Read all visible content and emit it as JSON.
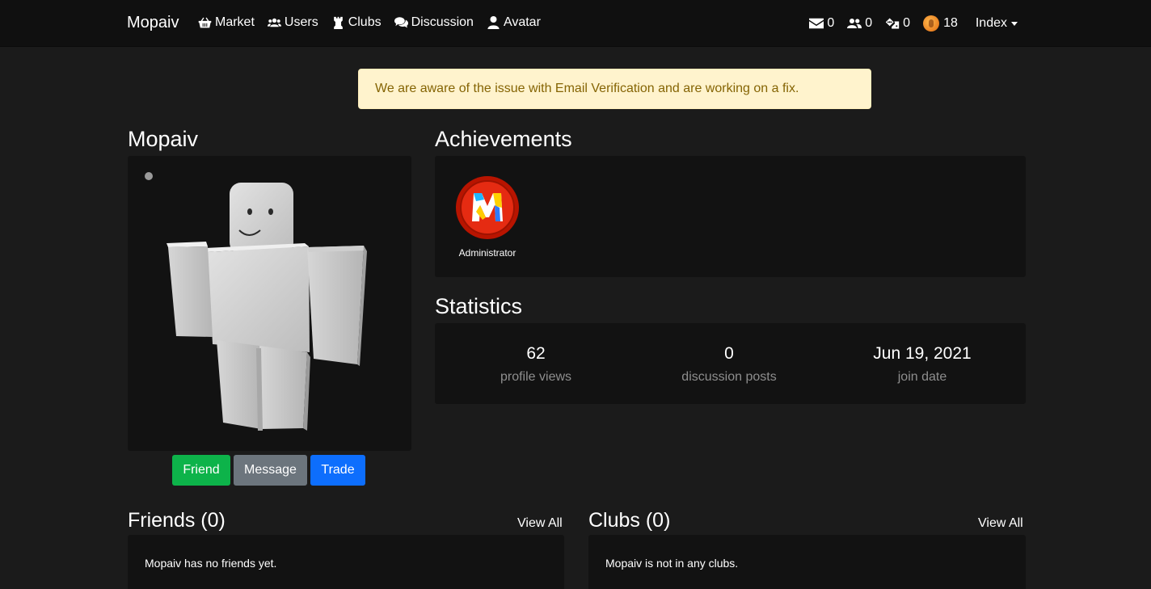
{
  "nav": {
    "brand": "Mopaiv",
    "links": [
      {
        "label": "Market",
        "icon": "basket-icon"
      },
      {
        "label": "Users",
        "icon": "users-icon"
      },
      {
        "label": "Clubs",
        "icon": "chess-rook-icon"
      },
      {
        "label": "Discussion",
        "icon": "comments-icon"
      },
      {
        "label": "Avatar",
        "icon": "user-icon"
      }
    ],
    "messages_count": "0",
    "friend_requests_count": "0",
    "trades_count": "0",
    "currency_amount": "18",
    "index_label": "Index"
  },
  "alert": {
    "text": "We are aware of the issue with Email Verification and are working on a fix."
  },
  "profile": {
    "username": "Mopaiv",
    "status": "offline",
    "buttons": {
      "friend": "Friend",
      "message": "Message",
      "trade": "Trade"
    }
  },
  "achievements": {
    "title": "Achievements",
    "items": [
      {
        "label": "Administrator",
        "icon": "administrator-badge-icon"
      }
    ]
  },
  "statistics": {
    "title": "Statistics",
    "profile_views": {
      "value": "62",
      "label": "profile views"
    },
    "discussion_posts": {
      "value": "0",
      "label": "discussion posts"
    },
    "join_date": {
      "value": "Jun 19, 2021",
      "label": "join date"
    }
  },
  "friends": {
    "title": "Friends (0)",
    "view_all": "View All",
    "empty": "Mopaiv has no friends yet."
  },
  "clubs": {
    "title": "Clubs (0)",
    "view_all": "View All",
    "empty": "Mopaiv is not in any clubs."
  },
  "colors": {
    "background": "#1b1b1b",
    "navbar": "#101010",
    "panel": "#121212",
    "alert_bg": "#fff3cd",
    "alert_text": "#856404",
    "friend_button": "#0db34a",
    "message_button": "#6c757d",
    "trade_button": "#0d6efd"
  }
}
